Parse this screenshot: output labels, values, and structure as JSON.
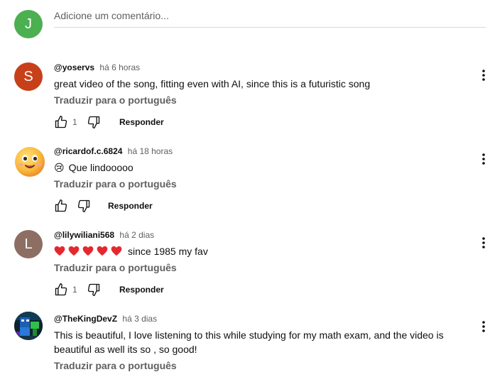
{
  "composer": {
    "avatar_letter": "J",
    "avatar_color": "#4caf50",
    "placeholder": "Adicione um comentário..."
  },
  "comments": [
    {
      "author": "@yoservs",
      "time": "há 6 horas",
      "text": "great video of the song, fitting even with AI, since this is a futuristic song",
      "translate": "Traduzir para o português",
      "likes": "1",
      "reply": "Responder",
      "avatar_letter": "S",
      "avatar_color": "#c8401a"
    },
    {
      "author": "@ricardof.c.6824",
      "time": "há 18 horas",
      "emoji": "😢",
      "text": "Que lindooooo",
      "translate": "Traduzir para o português",
      "likes": "",
      "reply": "Responder",
      "avatar_icon": "smiling-face-emoji"
    },
    {
      "author": "@lilywiliani568",
      "time": "há 2 dias",
      "hearts": 5,
      "text": "since 1985 my fav",
      "translate": "Traduzir para o português",
      "likes": "1",
      "reply": "Responder",
      "avatar_letter": "L",
      "avatar_color": "#8d6e63"
    },
    {
      "author": "@TheKingDevZ",
      "time": "há 3 dias",
      "text": "This is beautiful, I love listening to this while studying for my math exam, and the video is beautiful as well its so , so good!",
      "translate": "Traduzir para o português",
      "avatar_icon": "minecraft-character-image"
    }
  ],
  "icons": {
    "like": "thumbs-up-icon",
    "dislike": "thumbs-down-icon",
    "menu": "more-vertical-icon",
    "heart": "red-heart-emoji"
  }
}
